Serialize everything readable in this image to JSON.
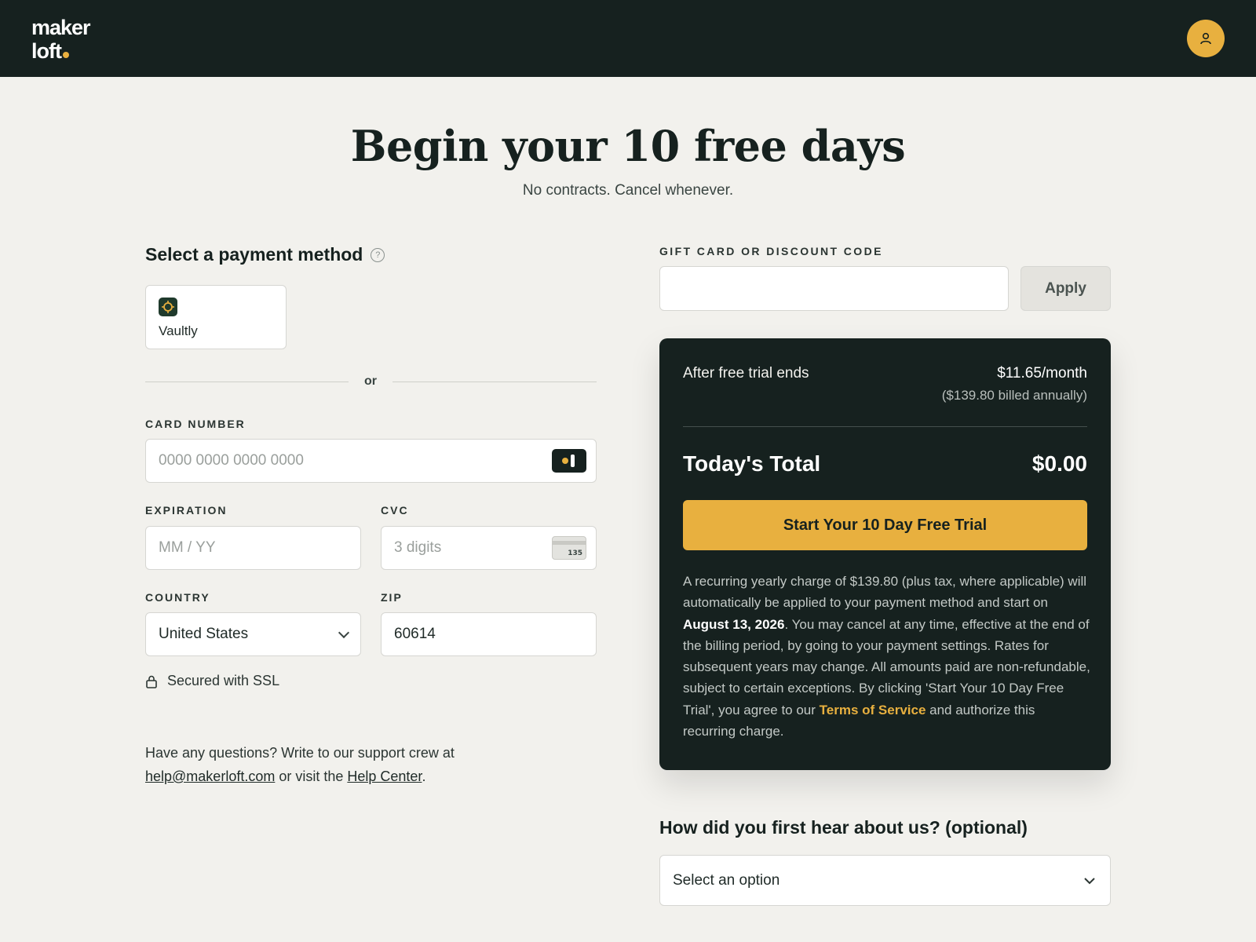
{
  "header": {
    "logo_line1": "maker",
    "logo_line2": "loft",
    "avatar_icon": "user-icon",
    "brand_color": "#16211f",
    "accent_color": "#e8b03f"
  },
  "hero": {
    "title": "Begin your 10 free days",
    "subtitle": "No contracts. Cancel whenever."
  },
  "payment": {
    "section_title": "Select a payment method",
    "help_icon": "question-circle-icon",
    "wallet_label": "Vaultly",
    "divider_text": "or",
    "card_number_label": "CARD NUMBER",
    "card_number_placeholder": "0000 0000 0000 0000",
    "expiration_label": "EXPIRATION",
    "expiration_placeholder": "MM / YY",
    "cvc_label": "CVC",
    "cvc_placeholder": "3 digits",
    "cvc_icon_text": "135",
    "country_label": "COUNTRY",
    "country_value": "United States",
    "zip_label": "ZIP",
    "zip_value": "60614",
    "ssl_text": "Secured with SSL"
  },
  "support": {
    "text_before": "Have any questions? Write to our support crew at ",
    "email": "help@makerloft.com",
    "text_middle": " or visit the ",
    "help_link": "Help Center",
    "text_after": "."
  },
  "discount": {
    "label": "GIFT CARD OR DISCOUNT CODE",
    "value": "",
    "apply_label": "Apply"
  },
  "summary": {
    "after_trial_label": "After free trial ends",
    "monthly_price": "$11.65/month",
    "annual_note": "($139.80 billed annually)",
    "total_label": "Today's Total",
    "total_value": "$0.00",
    "cta_label": "Start Your 10 Day Free Trial",
    "legal_part1": "A recurring yearly charge of $139.80 (plus tax, where applicable) will automatically be applied to your payment method and start on ",
    "legal_date": "August 13, 2026",
    "legal_part2": ". You may cancel at any time, effective at the end of the billing period, by going to your payment settings. Rates for subsequent years may change. All amounts paid are non-refundable, subject to certain exceptions. By clicking 'Start Your 10 Day Free Trial', you agree to our ",
    "terms_link": "Terms of Service",
    "legal_part3": " and authorize this recurring charge."
  },
  "survey": {
    "title": "How did you first hear about us? (optional)",
    "select_value": "Select an option"
  }
}
